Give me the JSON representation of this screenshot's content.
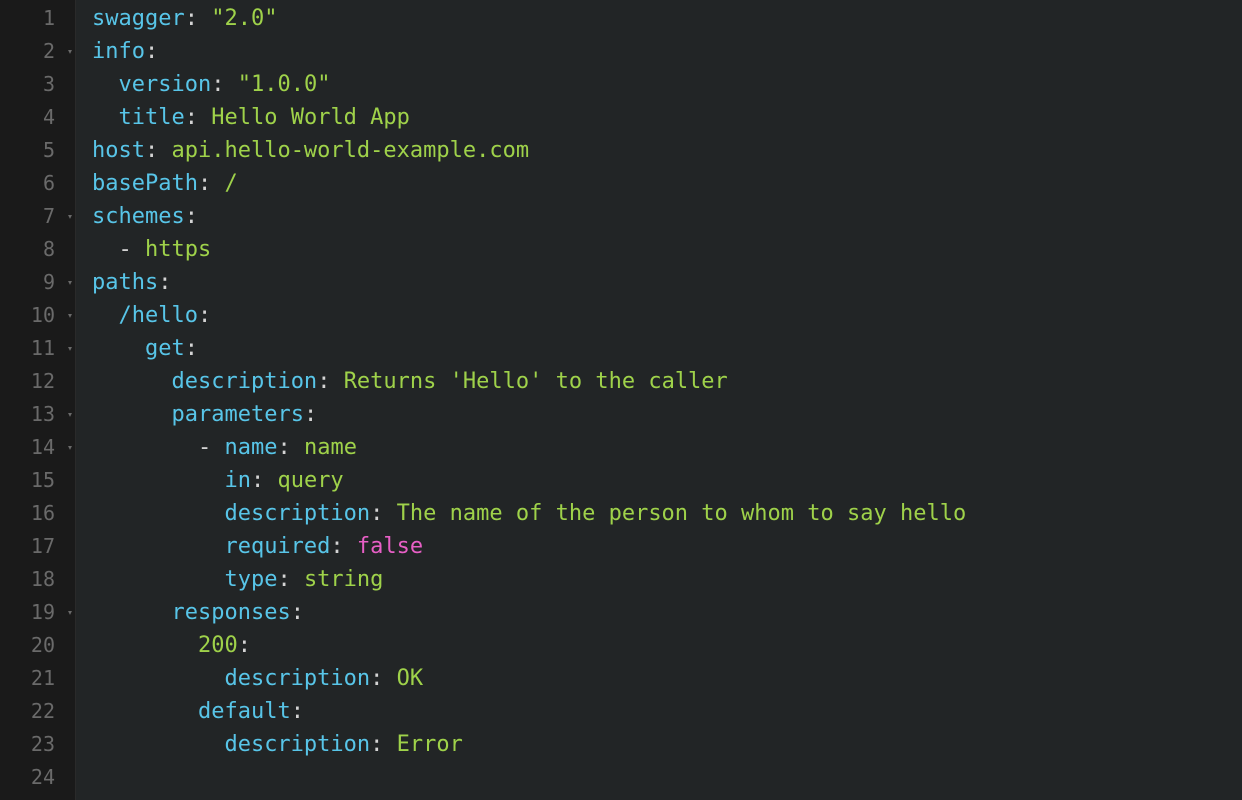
{
  "lines": [
    {
      "num": "1",
      "fold": false,
      "tokens": [
        {
          "text": "swagger",
          "cls": "key"
        },
        {
          "text": ": ",
          "cls": "punct"
        },
        {
          "text": "\"2.0\"",
          "cls": "string"
        }
      ]
    },
    {
      "num": "2",
      "fold": true,
      "tokens": [
        {
          "text": "info",
          "cls": "key"
        },
        {
          "text": ":",
          "cls": "punct"
        }
      ]
    },
    {
      "num": "3",
      "fold": false,
      "tokens": [
        {
          "text": "  ",
          "cls": "sp"
        },
        {
          "text": "version",
          "cls": "key"
        },
        {
          "text": ": ",
          "cls": "punct"
        },
        {
          "text": "\"1.0.0\"",
          "cls": "string"
        }
      ]
    },
    {
      "num": "4",
      "fold": false,
      "tokens": [
        {
          "text": "  ",
          "cls": "sp"
        },
        {
          "text": "title",
          "cls": "key"
        },
        {
          "text": ": ",
          "cls": "punct"
        },
        {
          "text": "Hello World App",
          "cls": "string"
        }
      ]
    },
    {
      "num": "5",
      "fold": false,
      "tokens": [
        {
          "text": "host",
          "cls": "key"
        },
        {
          "text": ": ",
          "cls": "punct"
        },
        {
          "text": "api.hello-world-example.com",
          "cls": "string"
        }
      ]
    },
    {
      "num": "6",
      "fold": false,
      "tokens": [
        {
          "text": "basePath",
          "cls": "key"
        },
        {
          "text": ": ",
          "cls": "punct"
        },
        {
          "text": "/",
          "cls": "string"
        }
      ]
    },
    {
      "num": "7",
      "fold": true,
      "tokens": [
        {
          "text": "schemes",
          "cls": "key"
        },
        {
          "text": ":",
          "cls": "punct"
        }
      ]
    },
    {
      "num": "8",
      "fold": false,
      "tokens": [
        {
          "text": "  ",
          "cls": "sp"
        },
        {
          "text": "- ",
          "cls": "dash"
        },
        {
          "text": "https",
          "cls": "string"
        }
      ]
    },
    {
      "num": "9",
      "fold": true,
      "tokens": [
        {
          "text": "paths",
          "cls": "key"
        },
        {
          "text": ":",
          "cls": "punct"
        }
      ]
    },
    {
      "num": "10",
      "fold": true,
      "tokens": [
        {
          "text": "  ",
          "cls": "sp"
        },
        {
          "text": "/hello",
          "cls": "key"
        },
        {
          "text": ":",
          "cls": "punct"
        }
      ]
    },
    {
      "num": "11",
      "fold": true,
      "tokens": [
        {
          "text": "    ",
          "cls": "sp"
        },
        {
          "text": "get",
          "cls": "key"
        },
        {
          "text": ":",
          "cls": "punct"
        }
      ]
    },
    {
      "num": "12",
      "fold": false,
      "tokens": [
        {
          "text": "      ",
          "cls": "sp"
        },
        {
          "text": "description",
          "cls": "key"
        },
        {
          "text": ": ",
          "cls": "punct"
        },
        {
          "text": "Returns 'Hello' to the caller",
          "cls": "string"
        }
      ]
    },
    {
      "num": "13",
      "fold": true,
      "tokens": [
        {
          "text": "      ",
          "cls": "sp"
        },
        {
          "text": "parameters",
          "cls": "key"
        },
        {
          "text": ":",
          "cls": "punct"
        }
      ]
    },
    {
      "num": "14",
      "fold": true,
      "tokens": [
        {
          "text": "        ",
          "cls": "sp"
        },
        {
          "text": "- ",
          "cls": "dash"
        },
        {
          "text": "name",
          "cls": "key"
        },
        {
          "text": ": ",
          "cls": "punct"
        },
        {
          "text": "name",
          "cls": "string"
        }
      ]
    },
    {
      "num": "15",
      "fold": false,
      "tokens": [
        {
          "text": "          ",
          "cls": "sp"
        },
        {
          "text": "in",
          "cls": "key"
        },
        {
          "text": ": ",
          "cls": "punct"
        },
        {
          "text": "query",
          "cls": "string"
        }
      ]
    },
    {
      "num": "16",
      "fold": false,
      "tokens": [
        {
          "text": "          ",
          "cls": "sp"
        },
        {
          "text": "description",
          "cls": "key"
        },
        {
          "text": ": ",
          "cls": "punct"
        },
        {
          "text": "The name of the person to whom to say hello",
          "cls": "string"
        }
      ]
    },
    {
      "num": "17",
      "fold": false,
      "tokens": [
        {
          "text": "          ",
          "cls": "sp"
        },
        {
          "text": "required",
          "cls": "key"
        },
        {
          "text": ": ",
          "cls": "punct"
        },
        {
          "text": "false",
          "cls": "boolean"
        }
      ]
    },
    {
      "num": "18",
      "fold": false,
      "tokens": [
        {
          "text": "          ",
          "cls": "sp"
        },
        {
          "text": "type",
          "cls": "key"
        },
        {
          "text": ": ",
          "cls": "punct"
        },
        {
          "text": "string",
          "cls": "string"
        }
      ]
    },
    {
      "num": "19",
      "fold": true,
      "tokens": [
        {
          "text": "      ",
          "cls": "sp"
        },
        {
          "text": "responses",
          "cls": "key"
        },
        {
          "text": ":",
          "cls": "punct"
        }
      ]
    },
    {
      "num": "20",
      "fold": false,
      "tokens": [
        {
          "text": "        ",
          "cls": "sp"
        },
        {
          "text": "200",
          "cls": "number-val"
        },
        {
          "text": ":",
          "cls": "punct"
        }
      ]
    },
    {
      "num": "21",
      "fold": false,
      "tokens": [
        {
          "text": "          ",
          "cls": "sp"
        },
        {
          "text": "description",
          "cls": "key"
        },
        {
          "text": ": ",
          "cls": "punct"
        },
        {
          "text": "OK",
          "cls": "string"
        }
      ]
    },
    {
      "num": "22",
      "fold": false,
      "tokens": [
        {
          "text": "        ",
          "cls": "sp"
        },
        {
          "text": "default",
          "cls": "key"
        },
        {
          "text": ":",
          "cls": "punct"
        }
      ]
    },
    {
      "num": "23",
      "fold": false,
      "tokens": [
        {
          "text": "          ",
          "cls": "sp"
        },
        {
          "text": "description",
          "cls": "key"
        },
        {
          "text": ": ",
          "cls": "punct"
        },
        {
          "text": "Error",
          "cls": "string"
        }
      ]
    },
    {
      "num": "24",
      "fold": false,
      "tokens": []
    }
  ],
  "fold_glyph": "▾"
}
